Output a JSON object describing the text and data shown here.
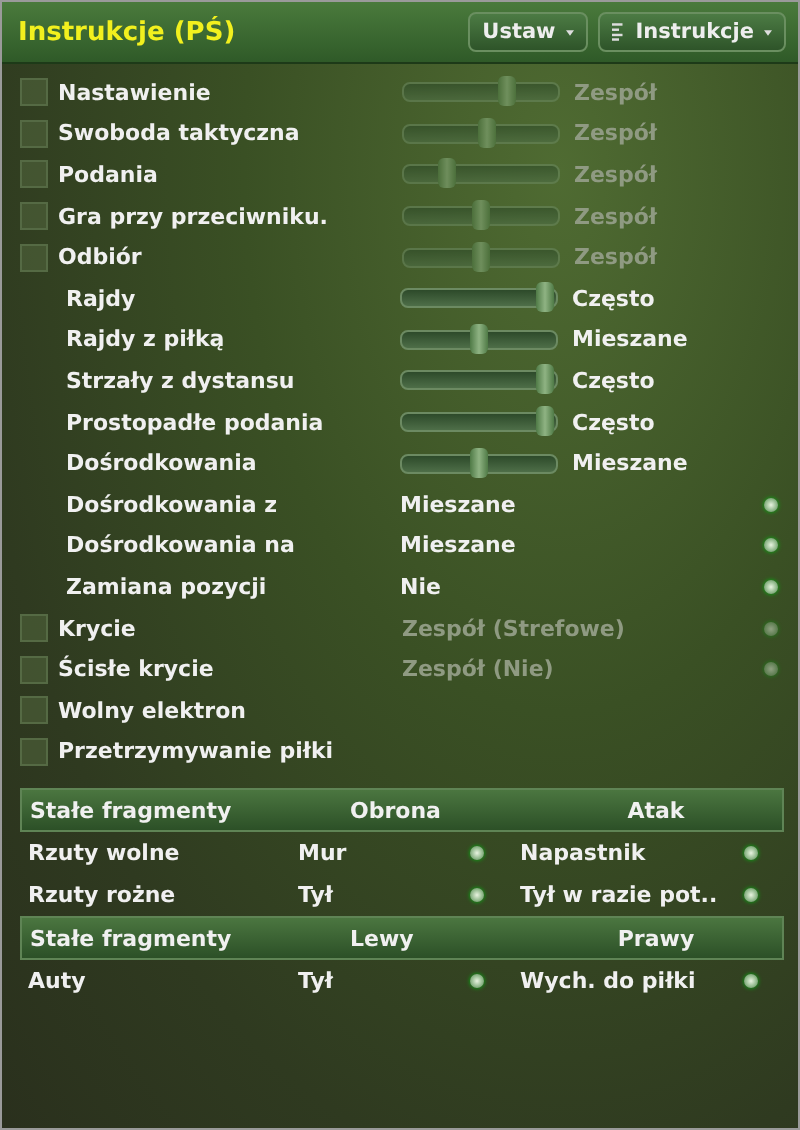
{
  "window": {
    "title": "Instrukcje (PŚ)"
  },
  "header_buttons": [
    {
      "label": "Ustaw",
      "icon": false
    },
    {
      "label": "Instrukcje",
      "icon": true
    }
  ],
  "rows": [
    {
      "kind": "slider",
      "label": "Nastawienie",
      "checked": false,
      "disabled": true,
      "level": 0.7,
      "reading": "Zespół"
    },
    {
      "kind": "slider",
      "label": "Swoboda taktyczna",
      "checked": false,
      "disabled": true,
      "level": 0.55,
      "reading": "Zespół"
    },
    {
      "kind": "slider",
      "label": "Podania",
      "checked": false,
      "disabled": true,
      "level": 0.25,
      "reading": "Zespół"
    },
    {
      "kind": "slider",
      "label": "Gra przy przeciwniku.",
      "checked": false,
      "disabled": true,
      "level": 0.5,
      "reading": "Zespół"
    },
    {
      "kind": "slider",
      "label": "Odbiór",
      "checked": false,
      "disabled": true,
      "level": 0.5,
      "reading": "Zespół"
    },
    {
      "kind": "slider",
      "label": "Rajdy",
      "disabled": false,
      "level": 1,
      "reading": "Często"
    },
    {
      "kind": "slider",
      "label": "Rajdy z piłką",
      "disabled": false,
      "level": 0.5,
      "reading": "Mieszane"
    },
    {
      "kind": "slider",
      "label": "Strzały z dystansu",
      "disabled": false,
      "level": 1,
      "reading": "Często"
    },
    {
      "kind": "slider",
      "label": "Prostopadłe podania",
      "disabled": false,
      "level": 1,
      "reading": "Często"
    },
    {
      "kind": "slider",
      "label": "Dośrodkowania",
      "disabled": false,
      "level": 0.5,
      "reading": "Mieszane"
    },
    {
      "kind": "dropdown",
      "label": "Dośrodkowania z",
      "disabled": false,
      "value": "Mieszane"
    },
    {
      "kind": "dropdown",
      "label": "Dośrodkowania na",
      "disabled": false,
      "value": "Mieszane"
    },
    {
      "kind": "dropdown",
      "label": "Zamiana pozycji",
      "disabled": false,
      "value": "Nie"
    },
    {
      "kind": "dropdown",
      "label": "Krycie",
      "checked": false,
      "disabled": true,
      "value": "Zespół (Strefowe)"
    },
    {
      "kind": "dropdown",
      "label": "Ścisłe krycie",
      "checked": false,
      "disabled": true,
      "value": "Zespół (Nie)"
    },
    {
      "kind": "checkbox",
      "label": "Wolny elektron",
      "checked": false
    },
    {
      "kind": "checkbox",
      "label": "Przetrzymywanie piłki",
      "checked": false
    }
  ],
  "set_pieces": [
    {
      "columns": [
        "Stałe fragmenty",
        "Obrona",
        "Atak"
      ],
      "rows": [
        {
          "label": "Rzuty wolne",
          "values": [
            "Mur",
            "Napastnik"
          ]
        },
        {
          "label": "Rzuty rożne",
          "values": [
            "Tył",
            "Tył w razie pot.."
          ]
        }
      ]
    },
    {
      "columns": [
        "Stałe fragmenty",
        "Lewy",
        "Prawy"
      ],
      "rows": [
        {
          "label": "Auty",
          "values": [
            "Tył",
            "Wych. do piłki"
          ]
        }
      ]
    }
  ]
}
